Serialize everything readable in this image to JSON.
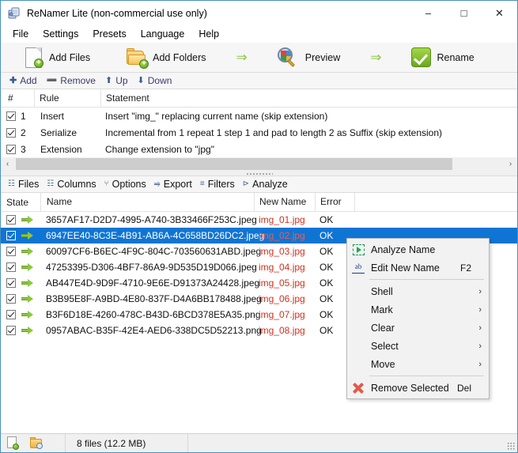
{
  "window": {
    "title": "ReNamer Lite (non-commercial use only)",
    "app_icon": "app-icon",
    "minimize": "–",
    "maximize": "□",
    "close": "✕"
  },
  "menubar": {
    "items": [
      {
        "label": "File"
      },
      {
        "label": "Settings"
      },
      {
        "label": "Presets"
      },
      {
        "label": "Language"
      },
      {
        "label": "Help"
      }
    ]
  },
  "toolbar": {
    "add_files": "Add Files",
    "add_folders": "Add Folders",
    "preview": "Preview",
    "rename": "Rename",
    "arrow": "⇒"
  },
  "rules_toolbar": {
    "add": "Add",
    "remove": "Remove",
    "up": "Up",
    "down": "Down",
    "add_glyph": "✚",
    "remove_glyph": "➖",
    "up_glyph": "⬆",
    "down_glyph": "⬇"
  },
  "rules": {
    "headers": {
      "num": "#",
      "rule": "Rule",
      "statement": "Statement"
    },
    "rows": [
      {
        "checked": true,
        "num": "1",
        "rule": "Insert",
        "statement": "Insert \"img_\" replacing current name (skip extension)"
      },
      {
        "checked": true,
        "num": "2",
        "rule": "Serialize",
        "statement": "Incremental from 1 repeat 1 step 1 and pad to length 2 as Suffix (skip extension)"
      },
      {
        "checked": true,
        "num": "3",
        "rule": "Extension",
        "statement": "Change extension to \"jpg\""
      }
    ]
  },
  "scrollbar": {
    "left_arrow": "‹",
    "right_arrow": "›"
  },
  "files_toolbar": {
    "items": [
      {
        "label": "Files",
        "glyph": "☷"
      },
      {
        "label": "Columns",
        "glyph": "☷"
      },
      {
        "label": "Options",
        "glyph": "⑂"
      },
      {
        "label": "Export",
        "glyph": "⥤"
      },
      {
        "label": "Filters",
        "glyph": "≡"
      },
      {
        "label": "Analyze",
        "glyph": "⊳"
      }
    ]
  },
  "files": {
    "headers": {
      "state": "State",
      "name": "Name",
      "new_name": "New Name",
      "error": "Error"
    },
    "rows": [
      {
        "checked": true,
        "name": "3657AF17-D2D7-4995-A740-3B33466F253C.jpeg",
        "new_name": "img_01.jpg",
        "error": "OK",
        "selected": false
      },
      {
        "checked": true,
        "name": "6947EE40-8C3E-4B91-AB6A-4C658BD26DC2.jpeg",
        "new_name": "img_02.jpg",
        "error": "OK",
        "selected": true
      },
      {
        "checked": true,
        "name": "60097CF6-B6EC-4F9C-804C-703560631ABD.jpeg",
        "new_name": "img_03.jpg",
        "error": "OK",
        "selected": false
      },
      {
        "checked": true,
        "name": "47253395-D306-4BF7-86A9-9D535D19D066.jpeg",
        "new_name": "img_04.jpg",
        "error": "OK",
        "selected": false
      },
      {
        "checked": true,
        "name": "AB447E4D-9D9F-4710-9E6E-D91373A24428.jpeg",
        "new_name": "img_05.jpg",
        "error": "OK",
        "selected": false
      },
      {
        "checked": true,
        "name": "B3B95E8F-A9BD-4E80-837F-D4A6BB178488.jpeg",
        "new_name": "img_06.jpg",
        "error": "OK",
        "selected": false
      },
      {
        "checked": true,
        "name": "B3F6D18E-4260-478C-B43D-6BCD378E5A35.png",
        "new_name": "img_07.jpg",
        "error": "OK",
        "selected": false
      },
      {
        "checked": true,
        "name": "0957ABAC-B35F-42E4-AED6-338DC5D52213.png",
        "new_name": "img_08.jpg",
        "error": "OK",
        "selected": false
      }
    ]
  },
  "context_menu": {
    "analyze_name": "Analyze Name",
    "edit_new_name": "Edit New Name",
    "edit_new_name_accel": "F2",
    "shell": "Shell",
    "mark": "Mark",
    "clear": "Clear",
    "select": "Select",
    "move": "Move",
    "remove_selected": "Remove Selected",
    "remove_selected_accel": "Del",
    "submenu_arrow": "›"
  },
  "statusbar": {
    "file_count": "8 files (12.2 MB)"
  },
  "colors": {
    "selection_blue": "#0f75d4",
    "new_name_red": "#d3301f",
    "accent_green": "#8cc63f",
    "window_border": "#4a90c0"
  }
}
